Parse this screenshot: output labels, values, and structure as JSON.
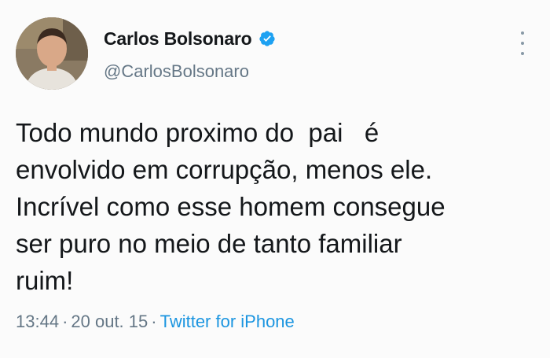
{
  "author": {
    "display_name": "Carlos Bolsonaro",
    "handle": "@CarlosBolsonaro",
    "verified": true,
    "verified_icon": "verified-badge-icon",
    "verified_color": "#1da1f2"
  },
  "menu": {
    "icon": "more-options-icon"
  },
  "tweet": {
    "lines": [
      "Todo mundo proximo do  pai   é",
      "envolvido em corrupção, menos ele.",
      "Incrível como esse homem consegue",
      "ser puro no meio de tanto familiar",
      "ruim!"
    ]
  },
  "meta": {
    "time": "13:44",
    "sep1": "·",
    "date": "20 out. 15",
    "sep2": "·",
    "source": "Twitter for iPhone",
    "source_color": "#1b95e0"
  }
}
